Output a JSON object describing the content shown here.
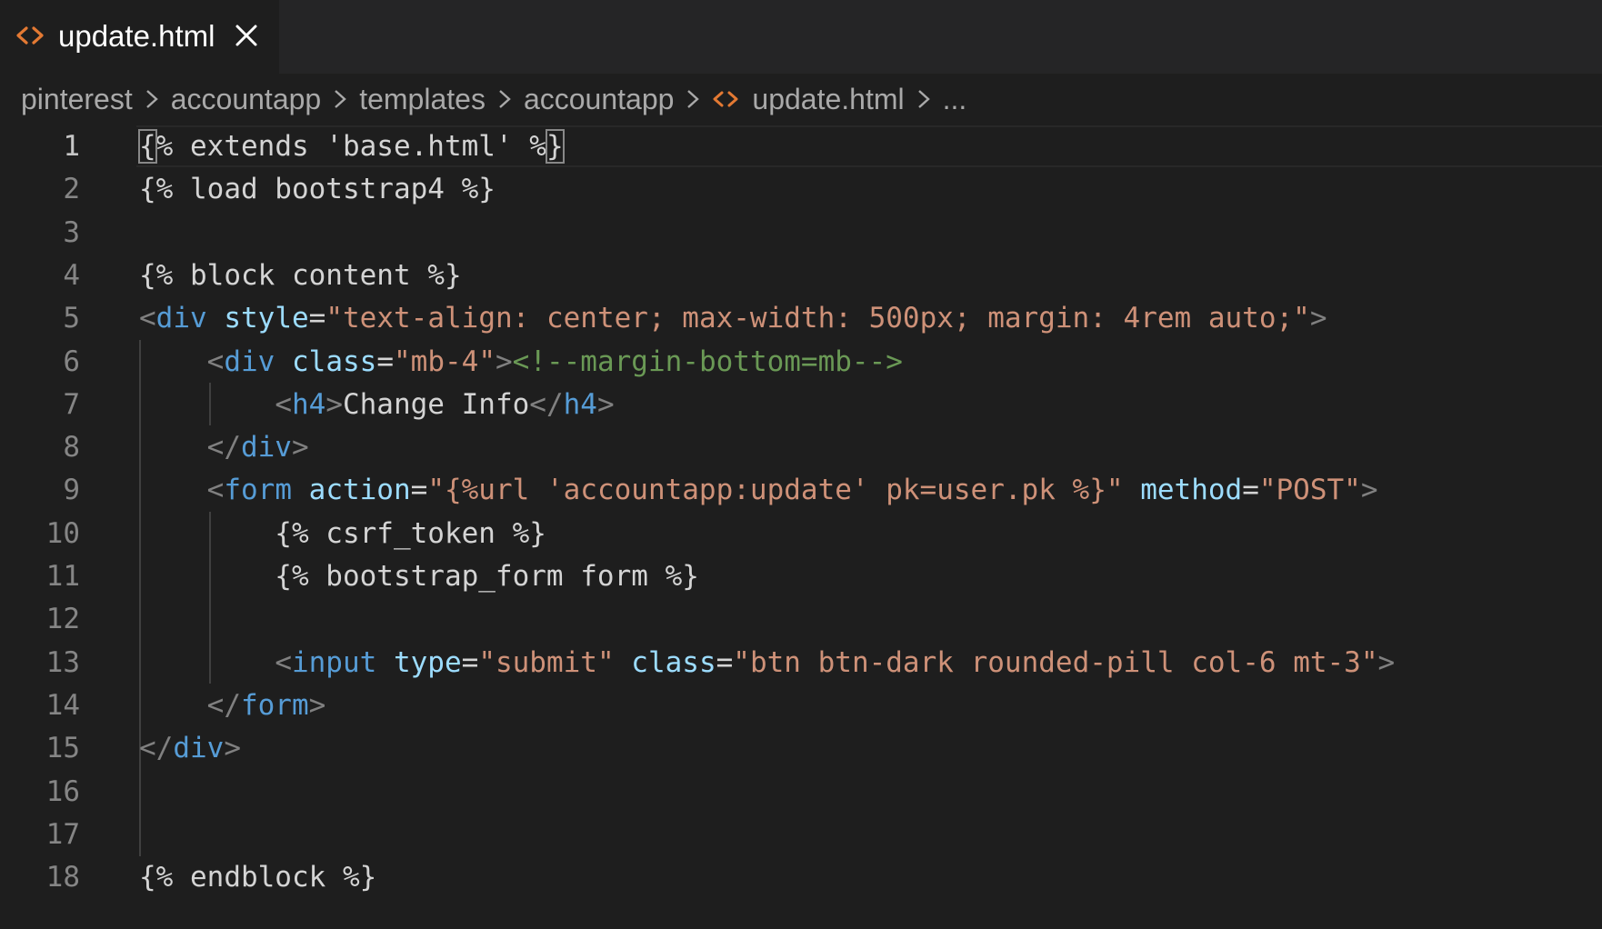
{
  "tab": {
    "label": "update.html",
    "icon": "html-file-icon",
    "close_icon": "close-icon",
    "accent_color": "#e37933"
  },
  "breadcrumb": {
    "items": [
      "pinterest",
      "accountapp",
      "templates",
      "accountapp",
      "update.html",
      "..."
    ],
    "separator_icon": "chevron-right-icon"
  },
  "editor": {
    "active_line": 1,
    "lines": [
      {
        "n": "1",
        "tokens": [
          [
            "p",
            "{% extends 'base.html' %}"
          ]
        ]
      },
      {
        "n": "2",
        "tokens": [
          [
            "p",
            "{% load bootstrap4 %}"
          ]
        ]
      },
      {
        "n": "3",
        "tokens": []
      },
      {
        "n": "4",
        "tokens": [
          [
            "p",
            "{% block content %}"
          ]
        ]
      },
      {
        "n": "5",
        "tokens": [
          [
            "u",
            "<"
          ],
          [
            "t",
            "div"
          ],
          [
            "p",
            " "
          ],
          [
            "a",
            "style"
          ],
          [
            "p",
            "="
          ],
          [
            "s",
            "\"text-align: center; max-width: 500px; margin: 4rem auto;\""
          ],
          [
            "u",
            ">"
          ]
        ]
      },
      {
        "n": "6",
        "tokens": [
          [
            "p",
            "    "
          ],
          [
            "u",
            "<"
          ],
          [
            "t",
            "div"
          ],
          [
            "p",
            " "
          ],
          [
            "a",
            "class"
          ],
          [
            "p",
            "="
          ],
          [
            "s",
            "\"mb-4\""
          ],
          [
            "u",
            ">"
          ],
          [
            "c",
            "<!--margin-bottom=mb-->"
          ]
        ]
      },
      {
        "n": "7",
        "tokens": [
          [
            "p",
            "        "
          ],
          [
            "u",
            "<"
          ],
          [
            "t",
            "h4"
          ],
          [
            "u",
            ">"
          ],
          [
            "p",
            "Change Info"
          ],
          [
            "u",
            "</"
          ],
          [
            "t",
            "h4"
          ],
          [
            "u",
            ">"
          ]
        ]
      },
      {
        "n": "8",
        "tokens": [
          [
            "p",
            "    "
          ],
          [
            "u",
            "</"
          ],
          [
            "t",
            "div"
          ],
          [
            "u",
            ">"
          ]
        ]
      },
      {
        "n": "9",
        "tokens": [
          [
            "p",
            "    "
          ],
          [
            "u",
            "<"
          ],
          [
            "t",
            "form"
          ],
          [
            "p",
            " "
          ],
          [
            "a",
            "action"
          ],
          [
            "p",
            "="
          ],
          [
            "s",
            "\"{%url 'accountapp:update' pk=user.pk %}\""
          ],
          [
            "p",
            " "
          ],
          [
            "a",
            "method"
          ],
          [
            "p",
            "="
          ],
          [
            "s",
            "\"POST\""
          ],
          [
            "u",
            ">"
          ]
        ]
      },
      {
        "n": "10",
        "tokens": [
          [
            "p",
            "        {% csrf_token %}"
          ]
        ]
      },
      {
        "n": "11",
        "tokens": [
          [
            "p",
            "        {% bootstrap_form form %}"
          ]
        ]
      },
      {
        "n": "12",
        "tokens": []
      },
      {
        "n": "13",
        "tokens": [
          [
            "p",
            "        "
          ],
          [
            "u",
            "<"
          ],
          [
            "t",
            "input"
          ],
          [
            "p",
            " "
          ],
          [
            "a",
            "type"
          ],
          [
            "p",
            "="
          ],
          [
            "s",
            "\"submit\""
          ],
          [
            "p",
            " "
          ],
          [
            "a",
            "class"
          ],
          [
            "p",
            "="
          ],
          [
            "s",
            "\"btn btn-dark rounded-pill col-6 mt-3\""
          ],
          [
            "u",
            ">"
          ]
        ]
      },
      {
        "n": "14",
        "tokens": [
          [
            "p",
            "    "
          ],
          [
            "u",
            "</"
          ],
          [
            "t",
            "form"
          ],
          [
            "u",
            ">"
          ]
        ]
      },
      {
        "n": "15",
        "tokens": [
          [
            "u",
            "</"
          ],
          [
            "t",
            "div"
          ],
          [
            "u",
            ">"
          ]
        ]
      },
      {
        "n": "16",
        "tokens": []
      },
      {
        "n": "17",
        "tokens": []
      },
      {
        "n": "18",
        "tokens": [
          [
            "p",
            "{% endblock %}"
          ]
        ]
      }
    ]
  }
}
